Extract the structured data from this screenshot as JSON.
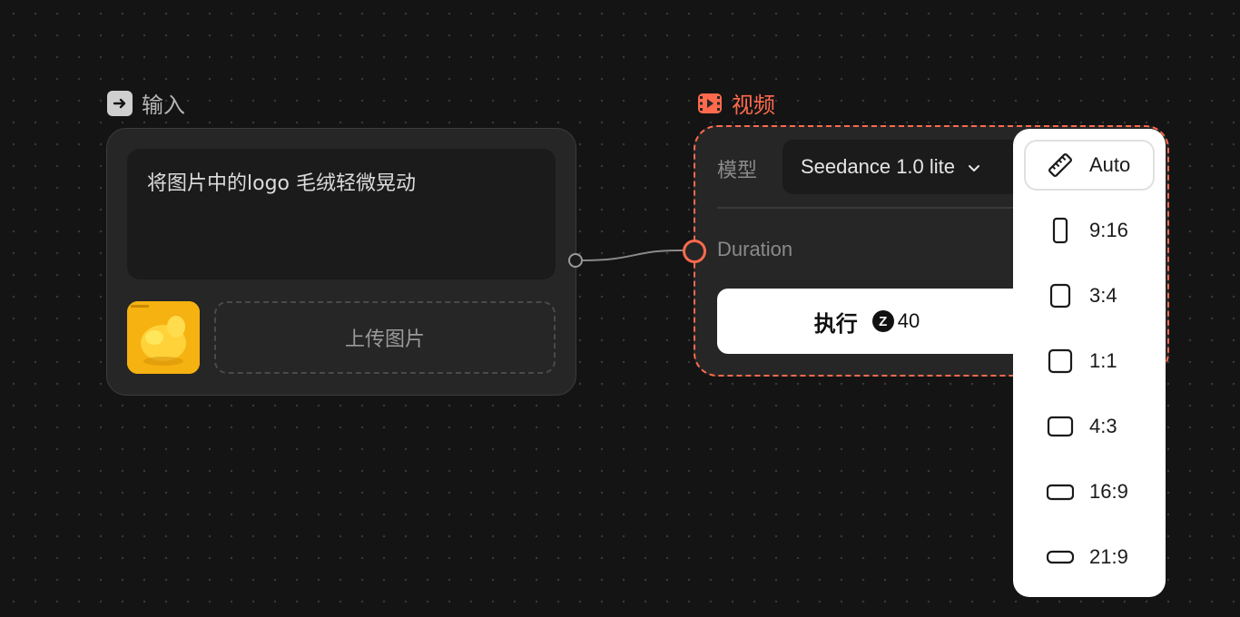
{
  "input_node": {
    "title": "输入",
    "prompt": "将图片中的logo 毛绒轻微晃动",
    "upload_label": "上传图片"
  },
  "video_node": {
    "title": "视频",
    "model_label": "模型",
    "model_value": "Seedance 1.0 lite",
    "duration_label": "Duration",
    "run_label": "执行",
    "cost": "40",
    "accent_color": "#ff6a4d"
  },
  "ratio_menu": {
    "selected": "Auto",
    "items": [
      {
        "label": "Auto",
        "icon": "ruler-icon"
      },
      {
        "label": "9:16",
        "icon": "portrait-ratio-icon"
      },
      {
        "label": "3:4",
        "icon": "portrait-ratio-icon"
      },
      {
        "label": "1:1",
        "icon": "square-ratio-icon"
      },
      {
        "label": "4:3",
        "icon": "landscape-ratio-icon"
      },
      {
        "label": "16:9",
        "icon": "landscape-ratio-icon"
      },
      {
        "label": "21:9",
        "icon": "wide-ratio-icon"
      }
    ]
  }
}
